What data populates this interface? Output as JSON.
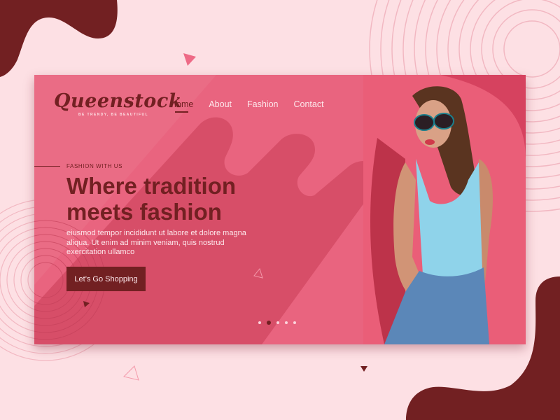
{
  "brand": {
    "name": "Queenstock",
    "tagline": "BE TRENDY, BE BEAUTIFUL"
  },
  "nav": {
    "items": [
      {
        "label": "Home",
        "active": true
      },
      {
        "label": "About",
        "active": false
      },
      {
        "label": "Fashion",
        "active": false
      },
      {
        "label": "Contact",
        "active": false
      }
    ]
  },
  "hero": {
    "eyebrow": "FASHION WITH US",
    "headline_line1": "Where tradition",
    "headline_line2": "meets fashion",
    "body": "eiusmod tempor incididunt ut labore et dolore magna aliqua. Ut enim ad minim veniam, quis nostrud exercitation ullamco",
    "cta_label": "Let’s Go Shopping"
  },
  "slider": {
    "total": 5,
    "active_index": 1
  },
  "image": {
    "alt": "Model in sunglasses, gingham top and denim shorts"
  },
  "colors": {
    "page_bg": "#fde0e4",
    "card_bg": "#e9647f",
    "accent_dark": "#722022",
    "stripe": "#d44a64"
  }
}
